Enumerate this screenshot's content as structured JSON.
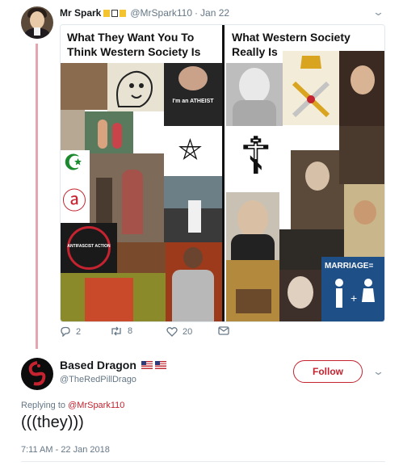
{
  "tweet": {
    "author_name": "Mr Spark",
    "author_handle": "@MrSpark110",
    "date": "Jan 22",
    "emoji_colors": [
      "#f4c430",
      "#ffffff",
      "#f4c430"
    ],
    "collage": {
      "left_title": "What They Want You To Think Western Society Is",
      "right_title": "What Western Society Really Is",
      "left_tiles": [
        {
          "label": "",
          "color": "#8b6b4e"
        },
        {
          "label": "",
          "color": "#e8e2d2"
        },
        {
          "label": "I'm an ATHEIST",
          "color": "#262626"
        },
        {
          "label": "",
          "color": "#b7a894"
        },
        {
          "label": "",
          "color": "#5a7a5e"
        },
        {
          "label": "☪",
          "color": "#ffffff"
        },
        {
          "label": "⛤",
          "color": "#ffffff"
        },
        {
          "label": "",
          "color": "#7d6a58"
        },
        {
          "label": "",
          "color": "#6d7f86"
        },
        {
          "label": "ⓐ",
          "color": "#ffffff"
        },
        {
          "label": "ANTIFASCIST ACTION",
          "color": "#1a1a1a"
        },
        {
          "label": "",
          "color": "#7a4a2c"
        },
        {
          "label": "",
          "color": "#9e3a1c"
        },
        {
          "label": "",
          "color": "#8a8a2a"
        }
      ],
      "right_tiles": [
        {
          "label": "",
          "color": "#bdbdbd"
        },
        {
          "label": "",
          "color": "#f3ecd8"
        },
        {
          "label": "",
          "color": "#3b2a22"
        },
        {
          "label": "☦",
          "color": "#ffffff"
        },
        {
          "label": "",
          "color": "#5b4a3a"
        },
        {
          "label": "",
          "color": "#4a3a2e"
        },
        {
          "label": "",
          "color": "#c9b68a"
        },
        {
          "label": "",
          "color": "#c9c2b4"
        },
        {
          "label": "",
          "color": "#b38a3d"
        },
        {
          "label": "",
          "color": "#2e2a26"
        },
        {
          "label": "MARRIAGE=",
          "color": "#1f4f87"
        },
        {
          "label": "",
          "color": "#8f7a4a"
        },
        {
          "label": "",
          "color": "#3d2f2a"
        }
      ]
    },
    "actions": {
      "replies": "2",
      "retweets": "8",
      "likes": "20"
    }
  },
  "reply": {
    "author_name": "Based Dragon",
    "author_handle": "@TheRedPillDrago",
    "follow_label": "Follow",
    "replying_prefix": "Replying to",
    "replying_handle": "@MrSpark110",
    "text": "(((they)))",
    "timestamp": "7:11 AM - 22 Jan 2018",
    "accent_color": "#c4232f"
  }
}
